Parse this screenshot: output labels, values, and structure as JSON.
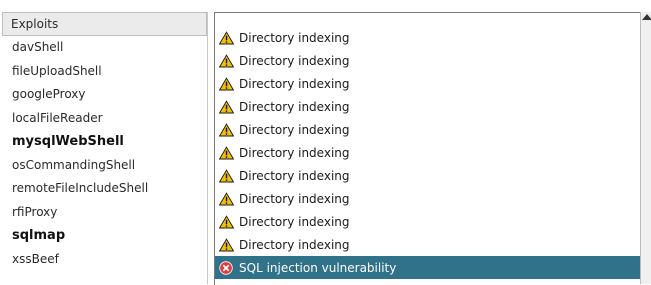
{
  "exploits_panel": {
    "header": "Exploits",
    "items": [
      {
        "label": "davShell",
        "bold": false
      },
      {
        "label": "fileUploadShell",
        "bold": false
      },
      {
        "label": "googleProxy",
        "bold": false
      },
      {
        "label": "localFileReader",
        "bold": false
      },
      {
        "label": "mysqlWebShell",
        "bold": true
      },
      {
        "label": "osCommandingShell",
        "bold": false
      },
      {
        "label": "remoteFileIncludeShell",
        "bold": false
      },
      {
        "label": "rfiProxy",
        "bold": false
      },
      {
        "label": "sqlmap",
        "bold": true
      },
      {
        "label": "xssBeef",
        "bold": false
      }
    ]
  },
  "vulns_panel": {
    "items": [
      {
        "label": "Directory indexing",
        "icon": "warning-icon"
      },
      {
        "label": "Directory indexing",
        "icon": "warning-icon"
      },
      {
        "label": "Directory indexing",
        "icon": "warning-icon"
      },
      {
        "label": "Directory indexing",
        "icon": "warning-icon"
      },
      {
        "label": "Directory indexing",
        "icon": "warning-icon"
      },
      {
        "label": "Directory indexing",
        "icon": "warning-icon"
      },
      {
        "label": "Directory indexing",
        "icon": "warning-icon"
      },
      {
        "label": "Directory indexing",
        "icon": "warning-icon"
      },
      {
        "label": "Directory indexing",
        "icon": "warning-icon"
      },
      {
        "label": "Directory indexing",
        "icon": "warning-icon"
      },
      {
        "label": "SQL injection vulnerability",
        "icon": "error-icon",
        "selected": true
      }
    ]
  },
  "colors": {
    "selection": "#31728b",
    "warning": "#f2c200",
    "error": "#e03c3c"
  }
}
